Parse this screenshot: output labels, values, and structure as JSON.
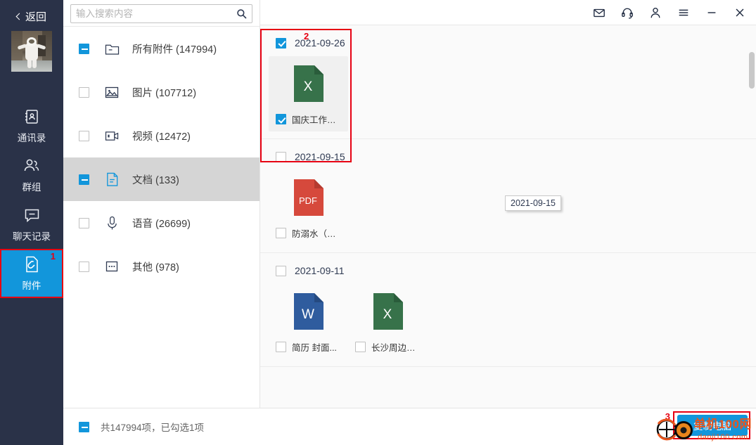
{
  "rail": {
    "back_label": "返回",
    "avatar_name": "user-avatar-photo",
    "items": [
      {
        "label": "通讯录",
        "icon": "contacts-icon",
        "active": false
      },
      {
        "label": "群组",
        "icon": "group-icon",
        "active": false
      },
      {
        "label": "聊天记录",
        "icon": "chat-history-icon",
        "active": false
      },
      {
        "label": "附件",
        "icon": "attachment-icon",
        "active": true,
        "badge": "1"
      }
    ]
  },
  "search": {
    "placeholder": "输入搜索内容",
    "value": "",
    "icon": "search-icon"
  },
  "categories": [
    {
      "label": "所有附件",
      "count": "(147994)",
      "icon": "folder-icon",
      "state": "indeterminate",
      "selected": false
    },
    {
      "label": "图片",
      "count": "(107712)",
      "icon": "image-icon",
      "state": "unchecked",
      "selected": false
    },
    {
      "label": "视频",
      "count": "(12472)",
      "icon": "video-icon",
      "state": "unchecked",
      "selected": false
    },
    {
      "label": "文档",
      "count": "(133)",
      "icon": "document-icon",
      "state": "indeterminate",
      "selected": true
    },
    {
      "label": "语音",
      "count": "(26699)",
      "icon": "microphone-icon",
      "state": "unchecked",
      "selected": false
    },
    {
      "label": "其他",
      "count": "(978)",
      "icon": "ellipsis-icon",
      "state": "unchecked",
      "selected": false
    }
  ],
  "titlebar": {
    "buttons": [
      {
        "name": "mail-icon"
      },
      {
        "name": "headset-icon"
      },
      {
        "name": "person-icon"
      },
      {
        "name": "menu-icon"
      },
      {
        "name": "minimize-icon"
      },
      {
        "name": "close-icon"
      }
    ]
  },
  "file_groups": [
    {
      "date": "2021-09-26",
      "checked": true,
      "files": [
        {
          "name": "国庆工作安...",
          "type": "excel",
          "checked": true,
          "selected": true
        }
      ]
    },
    {
      "date": "2021-09-15",
      "checked": false,
      "files": [
        {
          "name": "防溺水（转...",
          "type": "pdf",
          "checked": false,
          "selected": false
        }
      ]
    },
    {
      "date": "2021-09-11",
      "checked": false,
      "files": [
        {
          "name": "简历 封面...",
          "type": "word",
          "checked": false,
          "selected": false
        },
        {
          "name": "长沙周边旅...",
          "type": "excel",
          "checked": false,
          "selected": false
        }
      ]
    }
  ],
  "tooltip": {
    "text": "2021-09-15"
  },
  "statusbar": {
    "state": "indeterminate",
    "summary": "共147994项，已勾选1项",
    "action_label": "复制电脑"
  },
  "annotations": [
    {
      "num": "1",
      "target": "attachment-nav-item"
    },
    {
      "num": "2",
      "target": "first-date-group"
    },
    {
      "num": "3",
      "target": "action-button"
    }
  ],
  "watermark": {
    "line1": "单机100网",
    "line2": "danji100.com"
  },
  "colors": {
    "rail_bg": "#2a3248",
    "accent": "#1296db",
    "annotation": "#e60012",
    "excel": "#37724a",
    "word": "#2f5c9e",
    "pdf": "#d6493c",
    "watermark": "#e8541c"
  }
}
